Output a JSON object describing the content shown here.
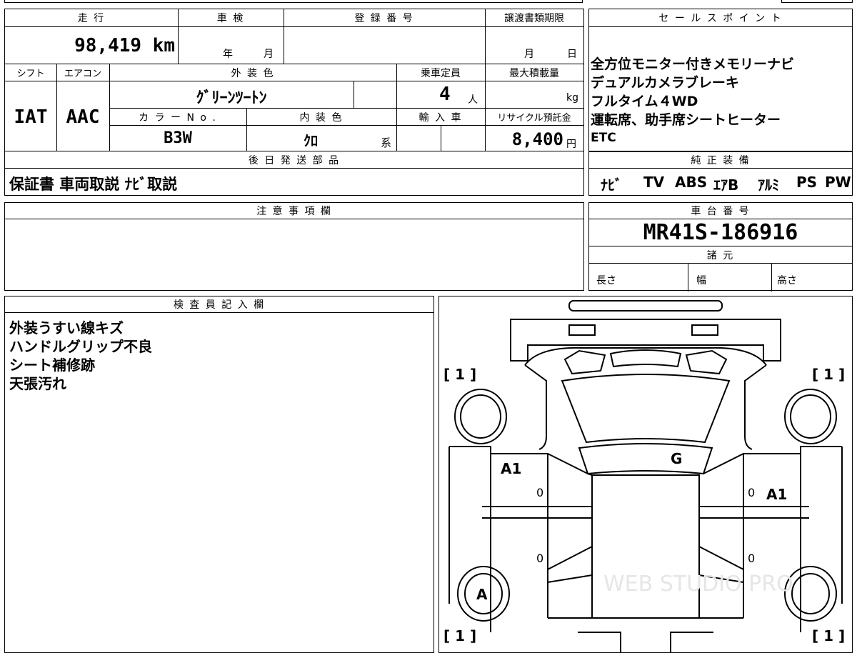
{
  "top_info": {
    "mileage_label": "走 行",
    "mileage": "98,419 km",
    "shaken_label": "車 検",
    "shaken_year": "年",
    "shaken_month": "月",
    "reg_label": "登 録 番 号",
    "deadline_label": "譲渡書類期限",
    "deadline_month": "月",
    "deadline_day": "日"
  },
  "specs": {
    "shift_label": "シフト",
    "shift": "IAT",
    "ac_label": "エアコン",
    "ac": "AAC",
    "exterior_label": "外 装 色",
    "exterior": "ｸﾞﾘｰﾝﾂｰﾄﾝ",
    "capacity_label": "乗車定員",
    "capacity": "4",
    "capacity_unit": "人",
    "load_label": "最大積載量",
    "load_unit": "kg",
    "color_no_label": "カ ラ ー N o .",
    "color_no": "B3W",
    "interior_label": "内 装 色",
    "interior": "ｸﾛ",
    "interior_suffix": "系",
    "import_label": "輸 入 車",
    "recycle_label": "リサイクル預託金",
    "recycle": "8,400",
    "recycle_unit": "円"
  },
  "later_parts": {
    "label": "後 日 発 送 部 品",
    "value": "保証書 車両取説 ﾅﾋﾞ取説"
  },
  "sales_points": {
    "label": "セ ー ル ス ポ イ ン ト",
    "lines": [
      "全方位モニター付きメモリーナビ",
      "デュアルカメラブレーキ",
      "フルタイム４WD",
      "運転席、助手席シートヒーター",
      "ETC"
    ]
  },
  "equipment": {
    "label": "純 正 装 備",
    "items": [
      "ﾅﾋﾞ",
      "TV",
      "ABS",
      "ｴｱB",
      "ｱﾙﾐ",
      "PS",
      "PW"
    ]
  },
  "notes": {
    "label": "注 意 事 項 欄"
  },
  "chassis": {
    "label": "車 台 番 号",
    "value": "MR41S-186916"
  },
  "dimensions": {
    "label": "諸 元",
    "length": "長さ",
    "width": "幅",
    "height": "高さ"
  },
  "inspector": {
    "label": "検 査 員 記 入 欄",
    "lines": [
      "外装うすい線キズ",
      "ハンドルグリップ不良",
      "シート補修跡",
      "天張汚れ"
    ]
  },
  "diagram": {
    "tire_marks": [
      "[ 1 ]",
      "[ 1 ]",
      "[ 1 ]",
      "[ 1 ]"
    ],
    "damage_marks": [
      "A1",
      "A1",
      "G",
      "A"
    ],
    "zero_marks": [
      "0",
      "0",
      "0",
      "0"
    ],
    "watermark": "WEB STUDIO PRO"
  }
}
